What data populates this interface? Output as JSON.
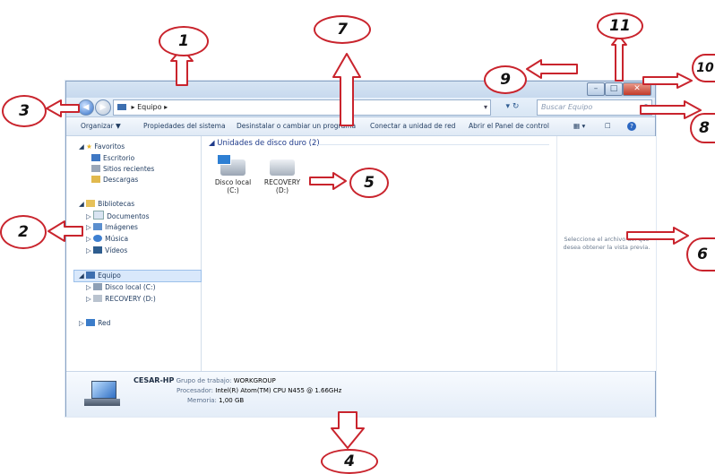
{
  "window": {
    "address_path": "Equipo",
    "search_placeholder": "Buscar Equipo",
    "toolbar": {
      "organize": "Organizar ▼",
      "items": [
        "Propiedades del sistema",
        "Desinstalar o cambiar un programa",
        "Conectar a unidad de red",
        "Abrir el Panel de control"
      ]
    },
    "nav": {
      "favorites": {
        "label": "Favoritos",
        "items": [
          "Escritorio",
          "Sitios recientes",
          "Descargas"
        ]
      },
      "libraries": {
        "label": "Bibliotecas",
        "items": [
          "Documentos",
          "Imágenes",
          "Música",
          "Vídeos"
        ]
      },
      "computer": {
        "label": "Equipo",
        "items": [
          "Disco local (C:)",
          "RECOVERY (D:)"
        ]
      },
      "network": {
        "label": "Red"
      }
    },
    "content": {
      "group_header": "Unidades de disco duro (2)",
      "drives": [
        {
          "line1": "Disco local",
          "line2": "(C:)"
        },
        {
          "line1": "RECOVERY",
          "line2": "(D:)"
        }
      ]
    },
    "preview_text": "Seleccione el archivo del que desea obtener la vista previa.",
    "details": {
      "computer_name": "CESAR-HP",
      "workgroup_label": "Grupo de trabajo:",
      "workgroup_value": "WORKGROUP",
      "processor_label": "Procesador:",
      "processor_value": "Intel(R) Atom(TM) CPU N455 @ 1.66GHz",
      "memory_label": "Memoria:",
      "memory_value": "1,00 GB"
    }
  },
  "callouts": [
    "1",
    "2",
    "3",
    "4",
    "5",
    "6",
    "7",
    "8",
    "9",
    "10",
    "11"
  ],
  "colors": {
    "callout_outline": "#c9242d",
    "window_border": "#8aa3c4",
    "link_text": "#1e3a5f"
  }
}
